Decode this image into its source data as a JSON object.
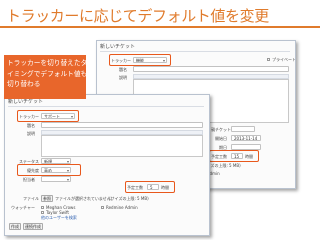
{
  "slide": {
    "title": "トラッカーに応じてデフォルト値を変更",
    "callout_lines": [
      "トラッカーを切り替えたタ",
      "イミングでデフォルト値も",
      "切り替わる"
    ],
    "accent_color": "#e07b2c",
    "highlight_color": "#e8581c"
  },
  "shot_a": {
    "heading": "新しいチケット",
    "tracker_label": "トラッカー",
    "tracker_value": "機能",
    "private_label": "プライベート",
    "subject_label": "題名",
    "description_label": "説明",
    "status_label": "ステータス",
    "status_value": "新規",
    "priority_label": "優先度",
    "priority_value": "通常",
    "assignee_label": "担当者",
    "assignee_value": "",
    "parent_label": "親チケット",
    "start_label": "開始日",
    "start_value": "2013-11-14",
    "due_label": "期日",
    "estimate_label": "予定工数",
    "estimate_value": "15",
    "estimate_unit": "時間",
    "file_label": "ファイル",
    "file_button": "参照",
    "file_note": "ファイルが選択されていません。",
    "file_size_note": "(サイズの上限: 5 MB)",
    "watchers_label": "ウォッチャー",
    "watchers": [
      "Meghan Crows",
      "Taylor Swift",
      "Redmine Admin"
    ],
    "search_link": "他のユーザーを検索",
    "create_button": "作成",
    "continue_button": "連続作成",
    "preview_link": "プレビュー"
  },
  "shot_b": {
    "heading": "新しいチケット",
    "tracker_label": "トラッカー",
    "tracker_value": "サポート",
    "subject_label": "題名",
    "description_label": "説明",
    "status_label": "ステータス",
    "status_value": "新規",
    "priority_label": "優先度",
    "priority_value": "高め",
    "assignee_label": "担当者",
    "assignee_value": "",
    "estimate_label": "予定工数",
    "estimate_value": "5",
    "estimate_unit": "時間",
    "file_label": "ファイル",
    "file_button": "参照",
    "file_note": "ファイルが選択されていません。",
    "file_size_note": "(サイズの上限: 5 MB)",
    "watchers_label": "ウォッチャー",
    "watchers": [
      "Meghan Crows",
      "Redmine Admin",
      "Taylor Swift"
    ],
    "search_link": "他のユーザーを検索",
    "create_button": "作成",
    "continue_button": "連続作成"
  }
}
